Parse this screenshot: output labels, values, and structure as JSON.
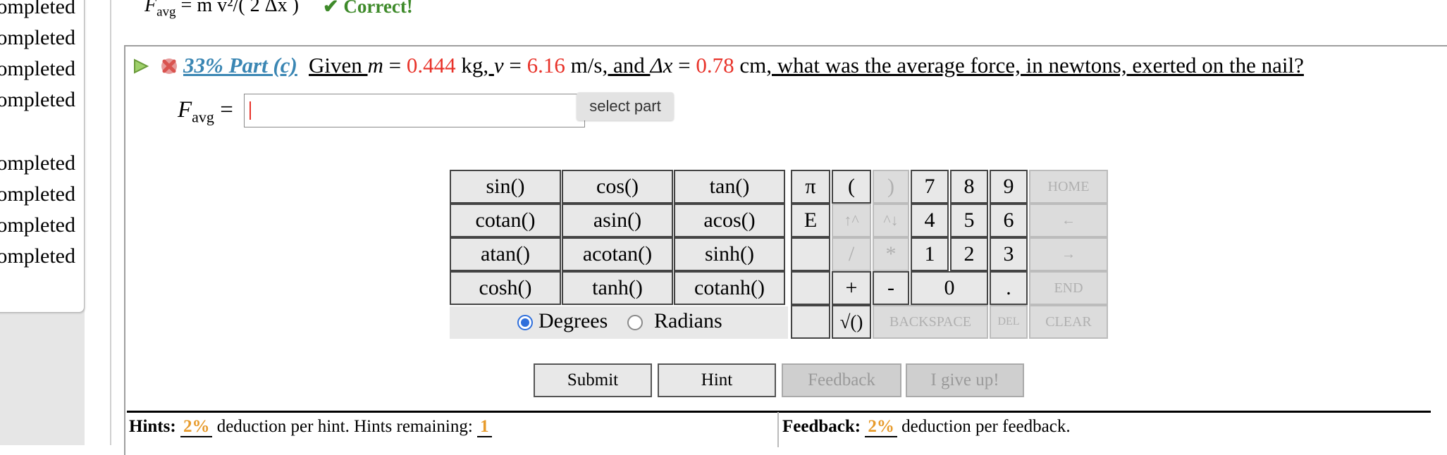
{
  "sidebar": {
    "items": [
      {
        "label": "Completed"
      },
      {
        "label": "Completed"
      },
      {
        "label": "Completed"
      },
      {
        "label": "Completed"
      },
      {
        "label": "Completed"
      },
      {
        "label": "Completed"
      },
      {
        "label": "Completed"
      },
      {
        "label": "Completed"
      }
    ]
  },
  "previous": {
    "var": "F",
    "sub": "avg",
    "expr": " = m v²/( 2 Δx )",
    "status": "✔ Correct!"
  },
  "part": {
    "percent_label": "33% Part (c)",
    "question_prefix": " Given ",
    "m_var": "m",
    "m_eq": " = ",
    "m_val": "0.444",
    "m_unit": " kg",
    "v_sep": ", ",
    "v_var": "v",
    "v_eq": " = ",
    "v_val": "6.16",
    "v_unit": " m/s",
    "x_sep": ", and ",
    "x_var": "Δx",
    "x_eq": " = ",
    "x_val": "0.78",
    "x_unit": " cm",
    "question_suffix": ", what was the average force, in newtons, exerted on the nail?"
  },
  "answer": {
    "var": "F",
    "sub": "avg",
    "eq": " = ",
    "value": "",
    "tooltip": "select part"
  },
  "keypad": {
    "functions": [
      [
        "sin()",
        "cos()",
        "tan()"
      ],
      [
        "cotan()",
        "asin()",
        "acos()"
      ],
      [
        "atan()",
        "acotan()",
        "sinh()"
      ],
      [
        "cosh()",
        "tanh()",
        "cotanh()"
      ]
    ],
    "pi": "π",
    "e": "E",
    "open_paren": "(",
    "close_paren": ")",
    "up": "↑^",
    "down": "^↓",
    "slash": "/",
    "star": "*",
    "plus": "+",
    "minus": "-",
    "sqrt": "√()",
    "digits": {
      "d7": "7",
      "d8": "8",
      "d9": "9",
      "d4": "4",
      "d5": "5",
      "d6": "6",
      "d1": "1",
      "d2": "2",
      "d3": "3",
      "d0": "0",
      "dot": "."
    },
    "home": "HOME",
    "left": "←",
    "right": "→",
    "end": "END",
    "backspace": "BACKSPACE",
    "del": "DEL",
    "clear": "CLEAR",
    "degrees": "Degrees",
    "radians": "Radians",
    "mode_selected": "Degrees"
  },
  "actions": {
    "submit": "Submit",
    "hint": "Hint",
    "feedback": "Feedback",
    "give_up": "I give up!"
  },
  "footer": {
    "hints_label": "Hints:",
    "hints_pct": "2%",
    "hints_text": " deduction per hint. Hints remaining: ",
    "hints_remaining": "1",
    "feedback_label": "Feedback:",
    "feedback_pct": "2%",
    "feedback_text": " deduction per feedback."
  },
  "colors": {
    "link": "#3a86b3",
    "value": "#e8332a",
    "correct": "#3e8a2a",
    "percent": "#e79b2c"
  }
}
